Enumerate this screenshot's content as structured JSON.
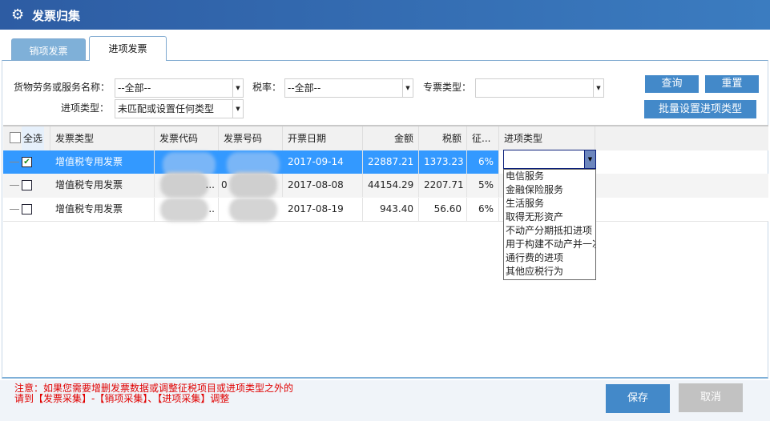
{
  "window": {
    "title": "发票归集",
    "icon": "gear-icon"
  },
  "tabs": [
    {
      "label": "销项发票",
      "active": false
    },
    {
      "label": "进项发票",
      "active": true
    }
  ],
  "filters": {
    "goods_label": "货物劳务或服务名称：",
    "goods_value": "--全部--",
    "rate_label": "税率：",
    "rate_value": "--全部--",
    "special_label": "专票类型：",
    "special_value": "",
    "input_type_label": "进项类型：",
    "input_type_value": "未匹配或设置任何类型"
  },
  "buttons": {
    "query": "查询",
    "reset": "重置",
    "batch": "批量设置进项类型",
    "save": "保存",
    "cancel": "取消"
  },
  "table": {
    "select_all": "全选",
    "columns": [
      "发票类型",
      "发票代码",
      "发票号码",
      "开票日期",
      "金额",
      "税额",
      "征...",
      "进项类型"
    ],
    "rows": [
      {
        "checked": true,
        "type": "增值税专用发票",
        "code": "",
        "number": "",
        "date": "2017-09-14",
        "amount": "22887.21",
        "tax": "1373.23",
        "rate": "6%"
      },
      {
        "checked": false,
        "type": "增值税专用发票",
        "code": "...",
        "number": "0",
        "date": "2017-08-08",
        "amount": "44154.29",
        "tax": "2207.71",
        "rate": "5%"
      },
      {
        "checked": false,
        "type": "增值税专用发票",
        "code": "..",
        "number": "",
        "date": "2017-08-19",
        "amount": "943.40",
        "tax": "56.60",
        "rate": "6%"
      }
    ]
  },
  "dropdown": {
    "value": "",
    "options": [
      "电信服务",
      "金融保险服务",
      "生活服务",
      "取得无形资产",
      "不动产分期抵扣进项",
      "用于构建不动产并一次",
      "通行费的进项",
      "其他应税行为"
    ]
  },
  "notice": {
    "line1": "注意：如果您需要增删发票数据或调整征税项目或进项类型之外的",
    "line2": "请到【发票采集】-【销项采集】、【进项采集】调整"
  }
}
